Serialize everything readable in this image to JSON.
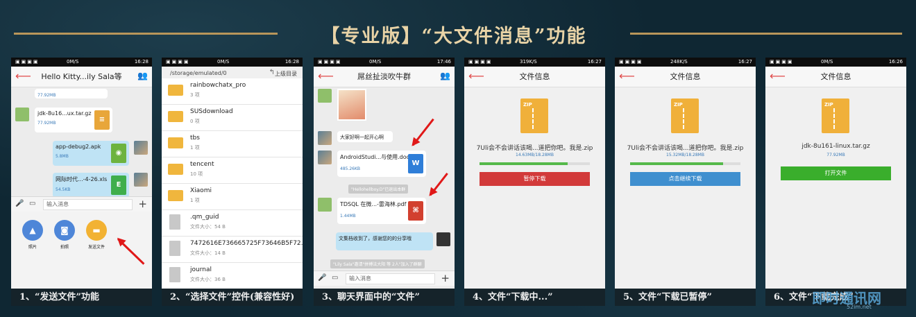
{
  "banner": {
    "title": "【专业版】“大文件消息”功能"
  },
  "captions": [
    "1、“发送文件”功能",
    "2、“选择文件”控件(兼容性好)",
    "3、聊天界面中的“文件”",
    "4、文件“下载中...”",
    "5、文件“下载已暂停”",
    "6、文件“下载完成”"
  ],
  "screen1": {
    "status": {
      "net": "0M/S",
      "time": "16:28"
    },
    "title": "Hello Kitty...ily Sala等",
    "msgs": [
      {
        "size": "77.92MB"
      },
      {
        "name": "jdk-8u16...ux.tar.gz",
        "size": "77.92MB"
      },
      {
        "name": "app-debug2.apk",
        "size": "5.8MB"
      },
      {
        "name": "网际时代...-4-26.xls",
        "size": "54.5KB"
      }
    ],
    "input_placeholder": "输入消息",
    "attach": [
      "照片",
      "拍照",
      "发送文件"
    ]
  },
  "screen2": {
    "status": {
      "net": "0M/S",
      "time": "16:28"
    },
    "path": "/storage/emulated/0",
    "up": "上级目录",
    "items": [
      {
        "name": "rainbowchatx_pro",
        "sub": "3 项",
        "type": "folder"
      },
      {
        "name": "SUSdownload",
        "sub": "0 项",
        "type": "folder"
      },
      {
        "name": "tbs",
        "sub": "1 项",
        "type": "folder"
      },
      {
        "name": "tencent",
        "sub": "10 项",
        "type": "folder"
      },
      {
        "name": "Xiaomi",
        "sub": "1 项",
        "type": "folder"
      },
      {
        "name": ".qm_guid",
        "sub": "文件大小：54 B",
        "type": "file"
      },
      {
        "name": "7472616E736665725F73646B5F72...",
        "sub": "文件大小：14 B",
        "type": "file"
      },
      {
        "name": "journal",
        "sub": "文件大小：36 B",
        "type": "file"
      }
    ]
  },
  "screen3": {
    "status": {
      "net": "0M/S",
      "time": "17:46"
    },
    "title": "屌丝扯淡吹牛群",
    "msgs": [
      {
        "text": "大家好啊一起开心啊"
      },
      {
        "name": "AndroidStudi...与使用.doc",
        "size": "485.26KB"
      },
      {
        "sys": "\"Hellohellboy.D\"已退出本群"
      },
      {
        "name": "TDSQL 在微...-雷海林.pdf",
        "size": "1.44MB"
      },
      {
        "text": "文集档收到了，感谢您的的分享哦"
      },
      {
        "sys": "\"Lily Sala\"邀请\"拼搏法大阳 等 2人\"加入了群聊"
      }
    ],
    "input_placeholder": "输入消息"
  },
  "screen4": {
    "status": {
      "net": "319K/S",
      "time": "16:27"
    },
    "title": "文件信息",
    "file": "7Uli会不会讲话该喝...道把你吧。我是.zip",
    "progress_text": "14.63MB/18.28MB",
    "progress": 0.8,
    "button": "暂停下载",
    "button_color": "#d23a3a"
  },
  "screen5": {
    "status": {
      "net": "248K/S",
      "time": "16:27"
    },
    "title": "文件信息",
    "file": "7Uli会不会讲话该喝...道把你吧。我是.zip",
    "progress_text": "15.32MB/18.28MB",
    "progress": 0.84,
    "button": "点击继续下载",
    "button_color": "#3f8fcf"
  },
  "screen6": {
    "status": {
      "net": "0M/S",
      "time": "16:26"
    },
    "title": "文件信息",
    "file": "jdk-8u161-linux.tar.gz",
    "size": "77.92MB",
    "button": "打开文件",
    "button_color": "#3aae2c"
  },
  "watermark": {
    "brand": "即时通讯网",
    "site": "52im.net"
  }
}
